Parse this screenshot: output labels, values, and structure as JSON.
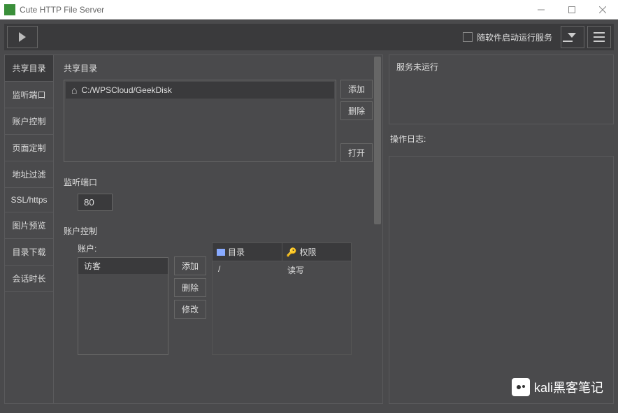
{
  "window": {
    "title": "Cute HTTP File Server",
    "icon_text": "CUTE"
  },
  "toolbar": {
    "autostart_label": "随软件启动运行服务"
  },
  "sidebar": {
    "items": [
      {
        "label": "共享目录"
      },
      {
        "label": "监听端口"
      },
      {
        "label": "账户控制"
      },
      {
        "label": "页面定制"
      },
      {
        "label": "地址过滤"
      },
      {
        "label": "SSL/https"
      },
      {
        "label": "图片预览"
      },
      {
        "label": "目录下载"
      },
      {
        "label": "会话时长"
      }
    ]
  },
  "share": {
    "title": "共享目录",
    "items": [
      {
        "path": "C:/WPSCloud/GeekDisk"
      }
    ],
    "buttons": {
      "add": "添加",
      "delete": "删除",
      "open": "打开"
    }
  },
  "listen": {
    "title": "监听端口",
    "port": "80"
  },
  "account": {
    "title": "账户控制",
    "list_label": "账户:",
    "items": [
      {
        "name": "访客"
      }
    ],
    "buttons": {
      "add": "添加",
      "delete": "删除",
      "edit": "修改"
    },
    "perm": {
      "headers": {
        "dir": "目录",
        "perm": "权限"
      },
      "rows": [
        {
          "dir": "/",
          "perm": "读写"
        }
      ]
    }
  },
  "status": {
    "text": "服务未运行"
  },
  "log": {
    "label": "操作日志:"
  },
  "watermark": {
    "text": "kali黑客笔记"
  }
}
